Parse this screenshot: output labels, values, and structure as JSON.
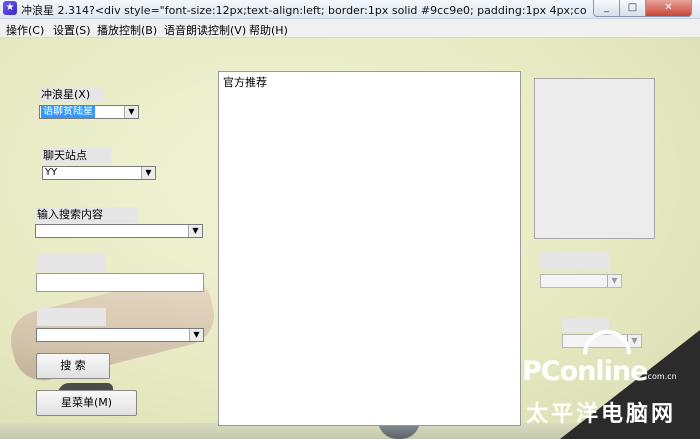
{
  "window": {
    "title": "冲浪星 2.314?<div style=\"font-size:12px;text-align:left; border:1px solid #9cc9e0; padding:1px 4px;color:#000000;font-fa...",
    "icon": "app-star-icon"
  },
  "menu": [
    {
      "label": "操作(C)"
    },
    {
      "label": "设置(S)"
    },
    {
      "label": "播放控制(B)"
    },
    {
      "label": "语音朗读控制(V)"
    },
    {
      "label": "帮助(H)"
    }
  ],
  "left": {
    "surf_star_label": "冲浪星(X)",
    "surf_star_value": "语聊贫陆星",
    "chat_site_label": "聊天站点",
    "chat_site_value": "YY",
    "search_label": "输入搜索内容",
    "search_value": "",
    "search_button": "搜 索",
    "star_menu_button": "星菜单(M)"
  },
  "center": {
    "panel_title": "官方推荐"
  },
  "watermark": {
    "logo": "PConline",
    "dotcom": ".com.cn",
    "cn": "太平洋电脑网"
  },
  "colors": {
    "selection": "#3399ff",
    "background": "#e9ebc9"
  }
}
